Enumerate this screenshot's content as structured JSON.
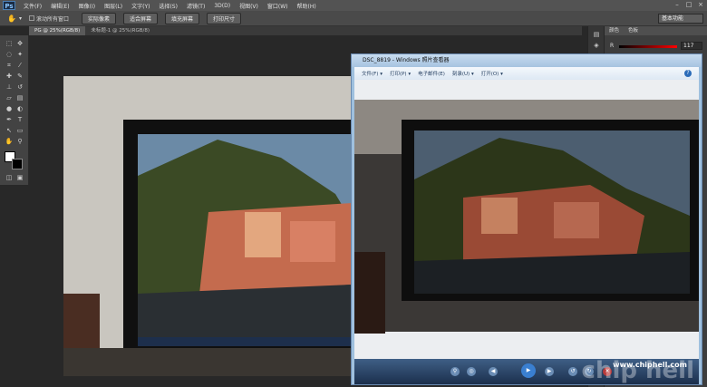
{
  "menubar": {
    "logo": "Ps",
    "items": [
      "文件(F)",
      "编辑(E)",
      "图像(I)",
      "图层(L)",
      "文字(Y)",
      "选择(S)",
      "滤镜(T)",
      "3D(D)",
      "视图(V)",
      "窗口(W)",
      "帮助(H)"
    ]
  },
  "options": {
    "checkbox_label": "滚动所有窗口",
    "buttons": [
      "实际像素",
      "适合屏幕",
      "填充屏幕",
      "打印尺寸"
    ],
    "workspace": "基本功能"
  },
  "tabs": [
    {
      "label": "PG @ 25%(RGB/8)",
      "active": true
    },
    {
      "label": "未标题-1 @ 25%(RGB/8)",
      "active": false
    }
  ],
  "panel": {
    "tabs": [
      "颜色",
      "色板"
    ],
    "channel": "R",
    "value": "117"
  },
  "viewer": {
    "title": "DSC_8819 - Windows 照片查看器",
    "menu": [
      "文件(F) ▾",
      "打印(P) ▾",
      "电子邮件(E)",
      "刻录(U) ▾",
      "打开(O) ▾"
    ],
    "help": "?",
    "watermark": "www.chiphell.com",
    "watermark_big": "chip hell"
  }
}
